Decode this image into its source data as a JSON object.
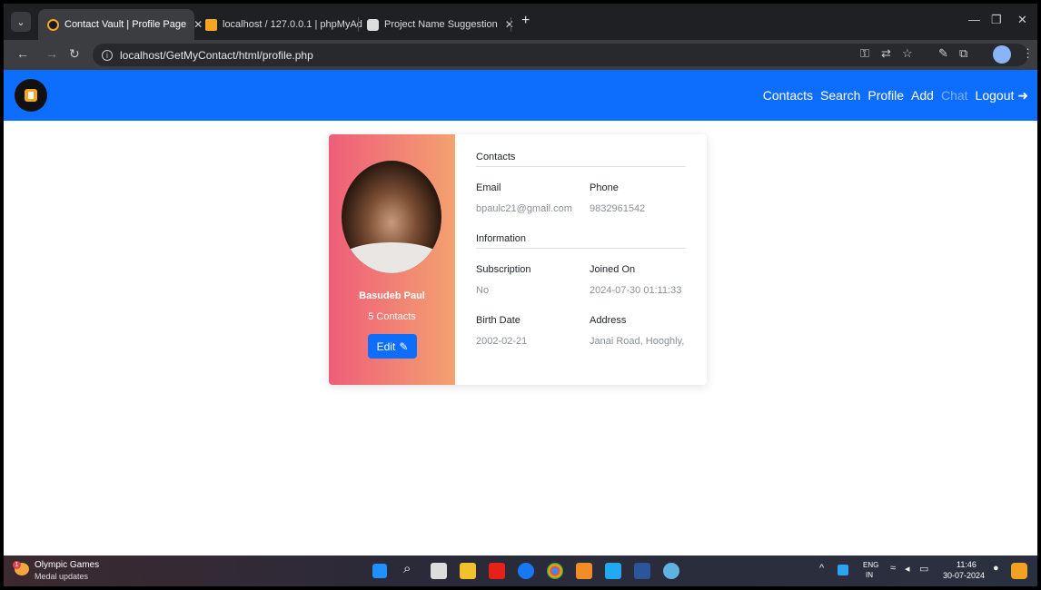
{
  "browser": {
    "tabs": [
      {
        "title": "Contact Vault | Profile Page",
        "favicon_color": "#f5a623",
        "close": "✕"
      },
      {
        "title": "localhost / 127.0.0.1 | phpMyAd",
        "favicon_color": "#f5a623",
        "close": "✕"
      },
      {
        "title": "Project Name Suggestion",
        "favicon_color": "#dddddd",
        "close": "✕"
      }
    ],
    "new_tab": "+",
    "url": "localhost/GetMyContact/html/profile.php"
  },
  "navbar": {
    "links": {
      "contacts": "Contacts",
      "search": "Search",
      "profile": "Profile",
      "add": "Add",
      "chat": "Chat",
      "logout": "Logout"
    }
  },
  "profile": {
    "name": "Basudeb Paul",
    "contacts_count": "5 Contacts",
    "edit_label": "Edit",
    "contacts_section": "Contacts",
    "email_label": "Email",
    "email_value": "bpaulc21@gmail.com",
    "phone_label": "Phone",
    "phone_value": "9832961542",
    "information_section": "Information",
    "subscription_label": "Subscription",
    "subscription_value": "No",
    "joined_label": "Joined On",
    "joined_value": "2024-07-30 01:11:33",
    "birth_label": "Birth Date",
    "birth_value": "2002-02-21",
    "address_label": "Address",
    "address_value": "Janai Road, Hooghly,"
  },
  "taskbar": {
    "news_title": "Olympic Games",
    "news_sub": "Medal updates",
    "news_badge": "1",
    "lang": "ENG",
    "region": "IN",
    "time": "11:46",
    "date": "30-07-2024"
  },
  "colors": {
    "navbar": "#0d6efd",
    "gradient_start": "#ee5d79",
    "gradient_end": "#f3a270"
  }
}
